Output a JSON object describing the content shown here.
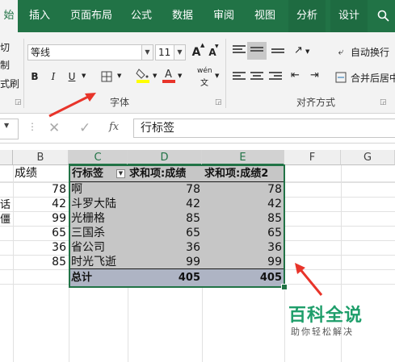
{
  "ribbon_tabs": [
    "始",
    "插入",
    "页面布局",
    "公式",
    "数据",
    "审阅",
    "视图",
    "分析",
    "设计"
  ],
  "ribbon": {
    "left_cut": [
      "切",
      "制",
      "式刷"
    ],
    "font_name": "等线",
    "font_size": "11",
    "bold": "B",
    "italic": "I",
    "underline": "U",
    "phonetic": "wén",
    "font_group_label": "字体",
    "align_group_label": "对齐方式",
    "wrap_text": "自动换行",
    "merge_center": "合并后居中",
    "grow_font": "A",
    "shrink_font": "A"
  },
  "formula_bar": {
    "fx": "fx",
    "content": "行标签"
  },
  "columns": [
    "B",
    "C",
    "D",
    "E",
    "F",
    "G"
  ],
  "left_cells": {
    "b_header": "成绩",
    "b_values": [
      "78",
      "42",
      "99",
      "65",
      "36",
      "85"
    ],
    "a_fragments": [
      "话",
      "僵"
    ]
  },
  "pivot": {
    "headers": [
      "行标签",
      "求和项:成绩",
      "求和项:成绩2"
    ],
    "rows": [
      {
        "label": "啊",
        "v1": "78",
        "v2": "78"
      },
      {
        "label": "斗罗大陆",
        "v1": "42",
        "v2": "42"
      },
      {
        "label": "光栅格",
        "v1": "85",
        "v2": "85"
      },
      {
        "label": "三国杀",
        "v1": "65",
        "v2": "65"
      },
      {
        "label": "省公司",
        "v1": "36",
        "v2": "36"
      },
      {
        "label": "时光飞逝",
        "v1": "99",
        "v2": "99"
      }
    ],
    "total": {
      "label": "总计",
      "v1": "405",
      "v2": "405"
    }
  },
  "watermark": {
    "main": "百科全说",
    "sub": "助你轻松解决"
  },
  "colors": {
    "excel_green": "#217346",
    "annotation_red": "#e8342a",
    "watermark_green": "#1e9e6a"
  }
}
